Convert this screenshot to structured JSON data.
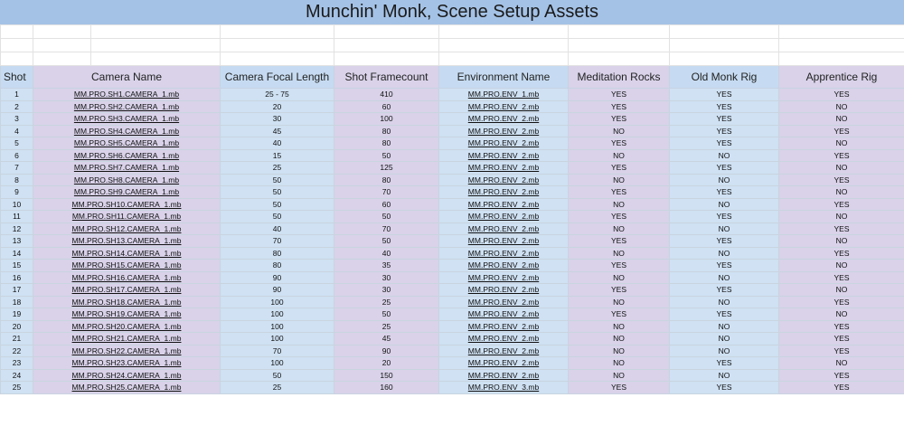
{
  "title": "Munchin' Monk, Scene Setup Assets",
  "headers": [
    "Shot",
    "Camera Name",
    "Camera Focal Length",
    "Shot Framecount",
    "Environment Name",
    "Meditation Rocks",
    "Old Monk Rig",
    "Apprentice Rig"
  ],
  "rows": [
    [
      "1",
      "MM.PRO.SH1.CAMERA_1.mb",
      "25 - 75",
      "410",
      "MM.PRO.ENV_1.mb",
      "YES",
      "YES",
      "YES"
    ],
    [
      "2",
      "MM.PRO.SH2.CAMERA_1.mb",
      "20",
      "60",
      "MM.PRO.ENV_2.mb",
      "YES",
      "YES",
      "NO"
    ],
    [
      "3",
      "MM.PRO.SH3.CAMERA_1.mb",
      "30",
      "100",
      "MM.PRO.ENV_2.mb",
      "YES",
      "YES",
      "NO"
    ],
    [
      "4",
      "MM.PRO.SH4.CAMERA_1.mb",
      "45",
      "80",
      "MM.PRO.ENV_2.mb",
      "NO",
      "YES",
      "YES"
    ],
    [
      "5",
      "MM.PRO.SH5.CAMERA_1.mb",
      "40",
      "80",
      "MM.PRO.ENV_2.mb",
      "YES",
      "YES",
      "NO"
    ],
    [
      "6",
      "MM.PRO.SH6.CAMERA_1.mb",
      "15",
      "50",
      "MM.PRO.ENV_2.mb",
      "NO",
      "NO",
      "YES"
    ],
    [
      "7",
      "MM.PRO.SH7.CAMERA_1.mb",
      "25",
      "125",
      "MM.PRO.ENV_2.mb",
      "YES",
      "YES",
      "NO"
    ],
    [
      "8",
      "MM.PRO.SH8.CAMERA_1.mb",
      "50",
      "80",
      "MM.PRO.ENV_2.mb",
      "NO",
      "NO",
      "YES"
    ],
    [
      "9",
      "MM.PRO.SH9.CAMERA_1.mb",
      "50",
      "70",
      "MM.PRO.ENV_2.mb",
      "YES",
      "YES",
      "NO"
    ],
    [
      "10",
      "MM.PRO.SH10.CAMERA_1.mb",
      "50",
      "60",
      "MM.PRO.ENV_2.mb",
      "NO",
      "NO",
      "YES"
    ],
    [
      "11",
      "MM.PRO.SH11.CAMERA_1.mb",
      "50",
      "50",
      "MM.PRO.ENV_2.mb",
      "YES",
      "YES",
      "NO"
    ],
    [
      "12",
      "MM.PRO.SH12.CAMERA_1.mb",
      "40",
      "70",
      "MM.PRO.ENV_2.mb",
      "NO",
      "NO",
      "YES"
    ],
    [
      "13",
      "MM.PRO.SH13.CAMERA_1.mb",
      "70",
      "50",
      "MM.PRO.ENV_2.mb",
      "YES",
      "YES",
      "NO"
    ],
    [
      "14",
      "MM.PRO.SH14.CAMERA_1.mb",
      "80",
      "40",
      "MM.PRO.ENV_2.mb",
      "NO",
      "NO",
      "YES"
    ],
    [
      "15",
      "MM.PRO.SH15.CAMERA_1.mb",
      "80",
      "35",
      "MM.PRO.ENV_2.mb",
      "YES",
      "YES",
      "NO"
    ],
    [
      "16",
      "MM.PRO.SH16.CAMERA_1.mb",
      "90",
      "30",
      "MM.PRO.ENV_2.mb",
      "NO",
      "NO",
      "YES"
    ],
    [
      "17",
      "MM.PRO.SH17.CAMERA_1.mb",
      "90",
      "30",
      "MM.PRO.ENV_2.mb",
      "YES",
      "YES",
      "NO"
    ],
    [
      "18",
      "MM.PRO.SH18.CAMERA_1.mb",
      "100",
      "25",
      "MM.PRO.ENV_2.mb",
      "NO",
      "NO",
      "YES"
    ],
    [
      "19",
      "MM.PRO.SH19.CAMERA_1.mb",
      "100",
      "50",
      "MM.PRO.ENV_2.mb",
      "YES",
      "YES",
      "NO"
    ],
    [
      "20",
      "MM.PRO.SH20.CAMERA_1.mb",
      "100",
      "25",
      "MM.PRO.ENV_2.mb",
      "NO",
      "NO",
      "YES"
    ],
    [
      "21",
      "MM.PRO.SH21.CAMERA_1.mb",
      "100",
      "45",
      "MM.PRO.ENV_2.mb",
      "NO",
      "NO",
      "YES"
    ],
    [
      "22",
      "MM.PRO.SH22.CAMERA_1.mb",
      "70",
      "90",
      "MM.PRO.ENV_2.mb",
      "NO",
      "NO",
      "YES"
    ],
    [
      "23",
      "MM.PRO.SH23.CAMERA_1.mb",
      "100",
      "20",
      "MM.PRO.ENV_2.mb",
      "NO",
      "YES",
      "NO"
    ],
    [
      "24",
      "MM.PRO.SH24.CAMERA_1.mb",
      "50",
      "150",
      "MM.PRO.ENV_2.mb",
      "NO",
      "NO",
      "YES"
    ],
    [
      "25",
      "MM.PRO.SH25.CAMERA_1.mb",
      "25",
      "160",
      "MM.PRO.ENV_3.mb",
      "YES",
      "YES",
      "YES"
    ]
  ],
  "colors": {
    "title_bg": "#a4c2e6",
    "blue_column": "#cfe1f3",
    "purple_column": "#d9d2e9",
    "link": "#1155cc"
  }
}
